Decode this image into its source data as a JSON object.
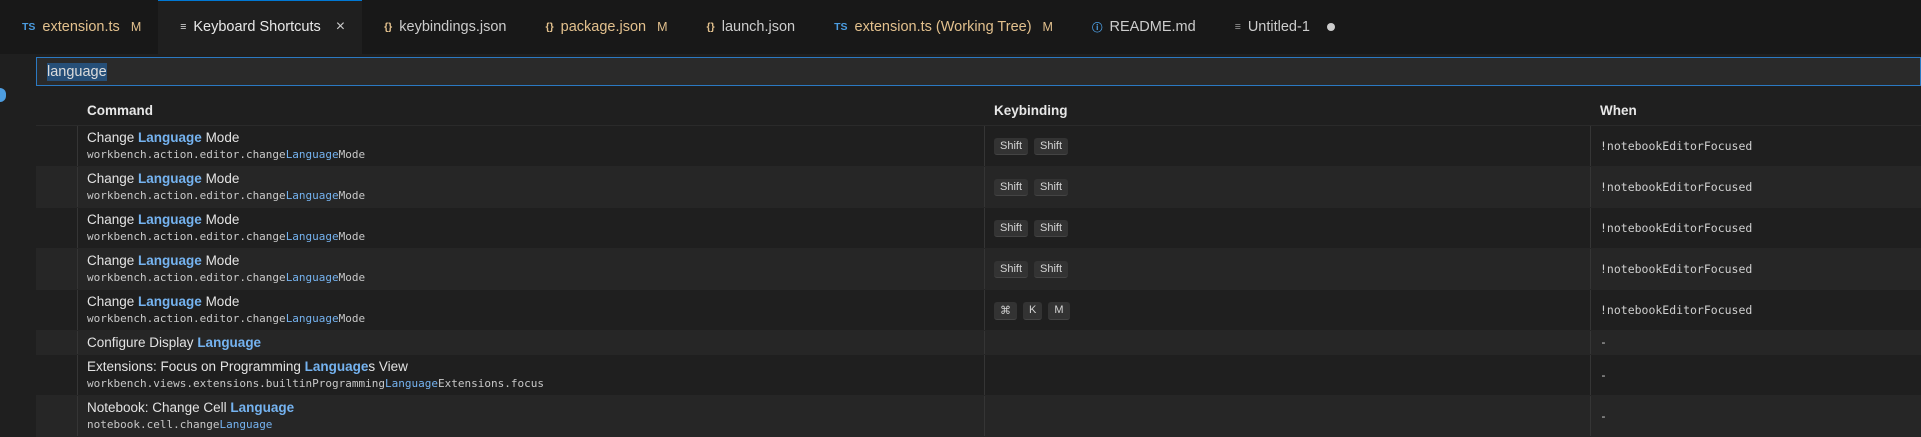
{
  "tabs": [
    {
      "icon": "TS",
      "label": "extension.ts",
      "status": "M",
      "color": "#e2c08d",
      "icon_color": "#4b9ce0"
    },
    {
      "icon": "≡",
      "label": "Keyboard Shortcuts",
      "status": "",
      "color": "#cccccc",
      "active": true
    },
    {
      "icon": "{}",
      "label": "keybindings.json",
      "status": "",
      "color": "#cccccc",
      "icon_color": "#e2c08d"
    },
    {
      "icon": "{}",
      "label": "package.json",
      "status": "M",
      "color": "#e2c08d",
      "icon_color": "#e2c08d"
    },
    {
      "icon": "{}",
      "label": "launch.json",
      "status": "",
      "color": "#cccccc",
      "icon_color": "#e2c08d"
    },
    {
      "icon": "TS",
      "label": "extension.ts (Working Tree)",
      "status": "M",
      "color": "#e2c08d",
      "icon_color": "#4b9ce0"
    },
    {
      "icon": "ⓘ",
      "label": "README.md",
      "status": "",
      "color": "#cccccc",
      "icon_color": "#4b9ce0"
    },
    {
      "icon": "≡",
      "label": "Untitled-1",
      "status": "",
      "color": "#cccccc"
    }
  ],
  "search": {
    "value": "language"
  },
  "table": {
    "headers": {
      "command": "Command",
      "keybinding": "Keybinding",
      "when": "When"
    },
    "rows": [
      {
        "title_pre": "Change ",
        "title_hl": "Language",
        "title_post": " Mode",
        "id_pre": "workbench.action.editor.change",
        "id_hl": "Language",
        "id_post": "Mode",
        "keys": [
          "Shift",
          "Shift"
        ],
        "when": "!notebookEditorFocused"
      },
      {
        "title_pre": "Change ",
        "title_hl": "Language",
        "title_post": " Mode",
        "id_pre": "workbench.action.editor.change",
        "id_hl": "Language",
        "id_post": "Mode",
        "keys": [
          "Shift",
          "Shift"
        ],
        "when": "!notebookEditorFocused"
      },
      {
        "title_pre": "Change ",
        "title_hl": "Language",
        "title_post": " Mode",
        "id_pre": "workbench.action.editor.change",
        "id_hl": "Language",
        "id_post": "Mode",
        "keys": [
          "Shift",
          "Shift"
        ],
        "when": "!notebookEditorFocused"
      },
      {
        "title_pre": "Change ",
        "title_hl": "Language",
        "title_post": " Mode",
        "id_pre": "workbench.action.editor.change",
        "id_hl": "Language",
        "id_post": "Mode",
        "keys": [
          "Shift",
          "Shift"
        ],
        "when": "!notebookEditorFocused"
      },
      {
        "title_pre": "Change ",
        "title_hl": "Language",
        "title_post": " Mode",
        "id_pre": "workbench.action.editor.change",
        "id_hl": "Language",
        "id_post": "Mode",
        "keys": [
          "⌘",
          "K",
          "M"
        ],
        "when": "!notebookEditorFocused"
      },
      {
        "title_pre": "Configure Display ",
        "title_hl": "Language",
        "title_post": "",
        "id_pre": "",
        "id_hl": "",
        "id_post": "",
        "keys": [],
        "when": "-"
      },
      {
        "title_pre": "Extensions: Focus on Programming ",
        "title_hl": "Language",
        "title_post": "s View",
        "id_pre": "workbench.views.extensions.builtinProgramming",
        "id_hl": "Language",
        "id_post": "Extensions.focus",
        "keys": [],
        "when": "-"
      },
      {
        "title_pre": "Notebook: Change Cell ",
        "title_hl": "Language",
        "title_post": "",
        "id_pre": "notebook.cell.change",
        "id_hl": "Language",
        "id_post": "",
        "keys": [],
        "when": "-"
      }
    ]
  }
}
